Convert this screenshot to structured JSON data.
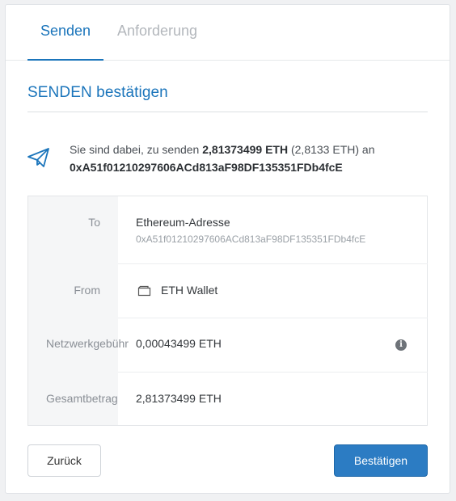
{
  "tabs": {
    "send": "Senden",
    "request": "Anforderung"
  },
  "section": {
    "title": "SENDEN bestätigen"
  },
  "summary": {
    "prefix": "Sie sind dabei, zu senden ",
    "amount": "2,81373499 ETH",
    "converted": " (2,8133 ETH) an",
    "address": "0xA51f01210297606ACd813aF98DF135351FDb4fcE"
  },
  "details": {
    "to_label": "To",
    "to_title": "Ethereum-Adresse",
    "to_address": "0xA51f01210297606ACd813aF98DF135351FDb4fcE",
    "from_label": "From",
    "from_wallet": "ETH Wallet",
    "fee_label": "Netzwerkgebühr",
    "fee_value": "0,00043499 ETH",
    "total_label": "Gesamtbetrag",
    "total_value": "2,81373499 ETH"
  },
  "buttons": {
    "back": "Zurück",
    "confirm": "Bestätigen"
  },
  "icons": {
    "send": "paper-plane-icon",
    "wallet": "wallet-icon",
    "info": "info-icon"
  },
  "colors": {
    "accent": "#1b75bb",
    "confirm_button": "#2c7cc3"
  }
}
